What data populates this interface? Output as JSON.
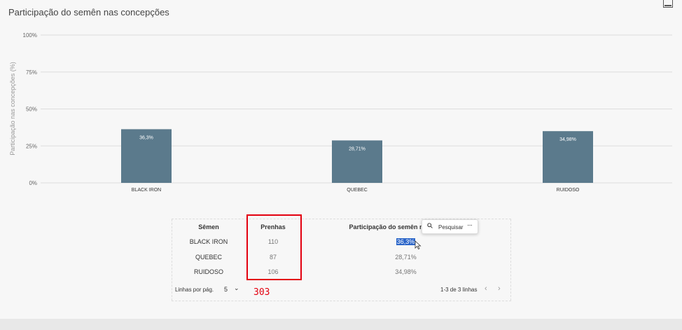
{
  "panel": {
    "title": "Participação do semên nas concepções"
  },
  "chart_data": {
    "type": "bar",
    "title": "Participação do semên nas concepções",
    "ylabel": "Participação nas concepções (%)",
    "xlabel": "",
    "categories": [
      "BLACK IRON",
      "QUEBEC",
      "RUIDOSO"
    ],
    "values": [
      36.3,
      28.71,
      34.98
    ],
    "data_labels": [
      "36,3%",
      "28,71%",
      "34,98%"
    ],
    "yticks": [
      "0%",
      "25%",
      "50%",
      "75%",
      "100%"
    ],
    "ylim": [
      0,
      100
    ],
    "bar_color": "#5b7a8c",
    "grid": true
  },
  "table": {
    "headers": [
      "Sêmen",
      "Prenhas",
      "Participação do semên na"
    ],
    "rows": [
      {
        "semen": "BLACK IRON",
        "prenhas": "110",
        "participacao": "36,3%"
      },
      {
        "semen": "QUEBEC",
        "prenhas": "87",
        "participacao": "28,71%"
      },
      {
        "semen": "RUIDOSO",
        "prenhas": "106",
        "participacao": "34,98%"
      }
    ],
    "selected_cell": "36,3%"
  },
  "popup": {
    "search_label": "Pesquisar",
    "more": "···"
  },
  "annotation": {
    "total": "303",
    "color": "#e3000f"
  },
  "pagination": {
    "rows_per_page_label": "Linhas por pág.",
    "rows_per_page_value": "5",
    "range_label": "1-3 de 3 linhas"
  }
}
